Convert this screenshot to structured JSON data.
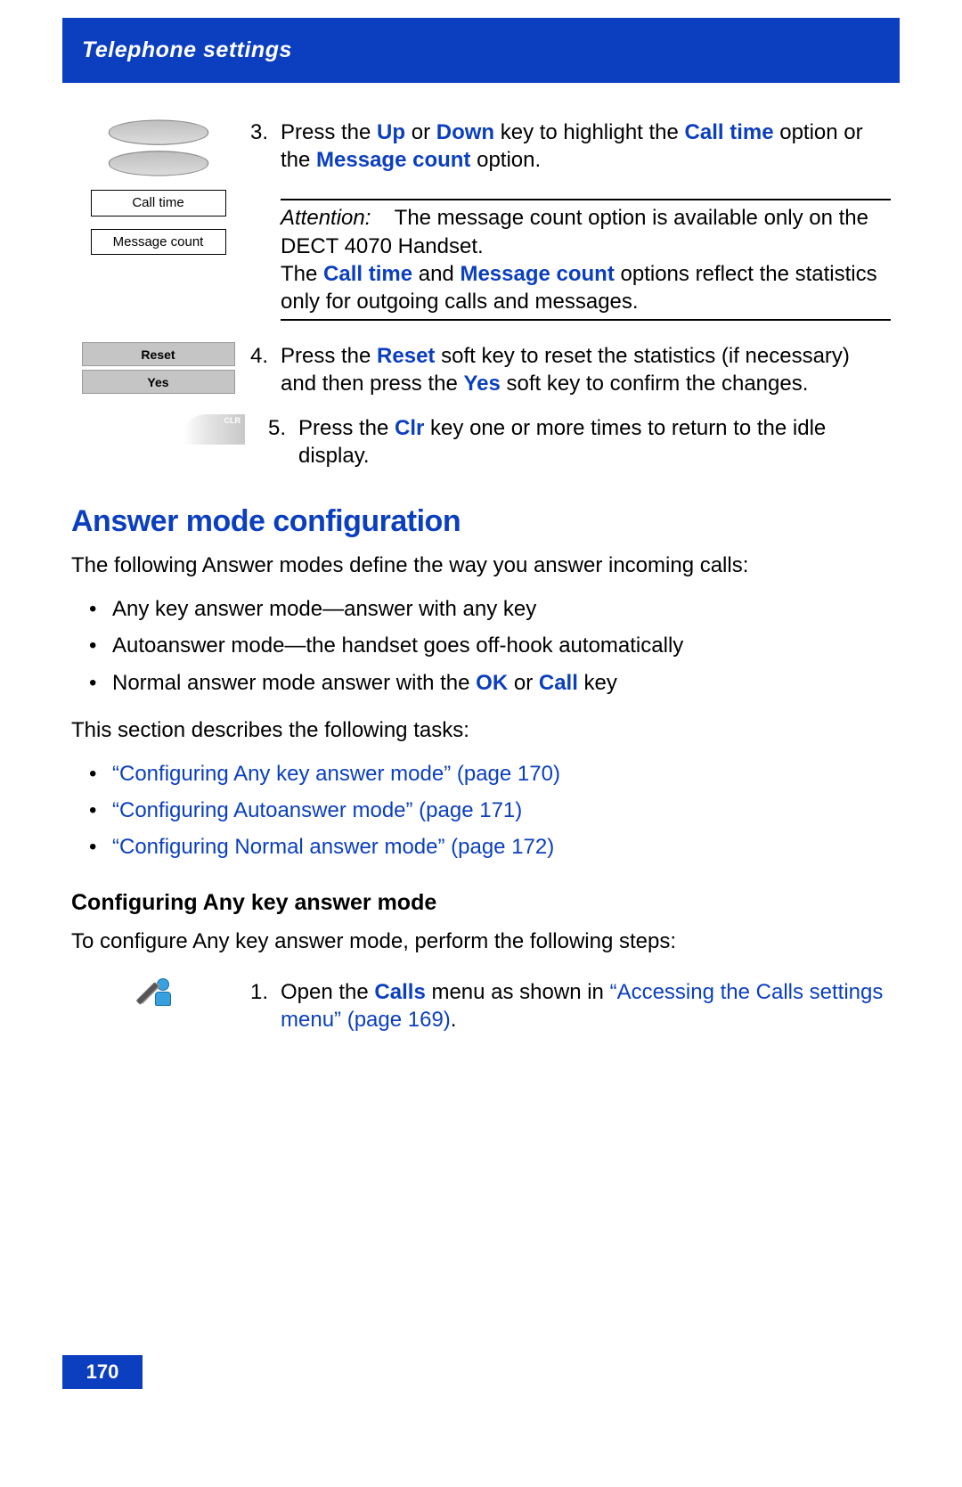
{
  "header": {
    "title": "Telephone settings"
  },
  "step3": {
    "num": "3.",
    "t1": "Press the ",
    "up": "Up",
    "t2": " or ",
    "down": "Down",
    "t3": " key to highlight the ",
    "calltime": "Call time",
    "t4": " option or the ",
    "msgcount": "Message count",
    "t5": " option."
  },
  "illus": {
    "opt1": "Call time",
    "opt2": "Message count",
    "reset": "Reset",
    "yes": "Yes",
    "clr": "CLR"
  },
  "note": {
    "attn": "Attention:",
    "line1_a": "The message count option is available only on the DECT 4070 Handset.",
    "line2_a": "The ",
    "calltime": "Call time",
    "line2_b": " and ",
    "msgcount": "Message count",
    "line2_c": " options reflect the statistics only for outgoing calls and messages."
  },
  "step4": {
    "num": "4.",
    "t1": "Press the ",
    "reset": "Reset",
    "t2": " soft key to reset the statistics (if necessary) and then press the ",
    "yes": "Yes",
    "t3": " soft key to confirm the changes."
  },
  "step5": {
    "num": "5.",
    "t1": "Press the ",
    "clr": "Clr",
    "t2": " key one or more times to return to the idle display."
  },
  "section": {
    "title": "Answer mode configuration"
  },
  "intro": "The following Answer modes define the way you answer incoming calls:",
  "modes": {
    "b1": "Any key answer mode—answer with any key",
    "b2": "Autoanswer mode—the handset goes off-hook automatically",
    "b3a": "Normal answer mode   answer with the ",
    "ok": "OK",
    "b3b": " or ",
    "call": "Call",
    "b3c": " key"
  },
  "tasks_intro": "This section describes the following tasks:",
  "links": {
    "l1": "“Configuring Any key answer mode” (page 170)",
    "l2": "“Configuring Autoanswer mode” (page 171)",
    "l3": "“Configuring Normal answer mode” (page 172)"
  },
  "subhead": "Configuring Any key answer mode",
  "subintro": "To configure Any key answer mode, perform the following steps:",
  "step1": {
    "num": "1.",
    "t1": "Open the ",
    "calls": "Calls",
    "t2": " menu as shown in ",
    "link": "“Accessing the Calls settings menu” (page 169)",
    "t3": "."
  },
  "pagenum": "170"
}
